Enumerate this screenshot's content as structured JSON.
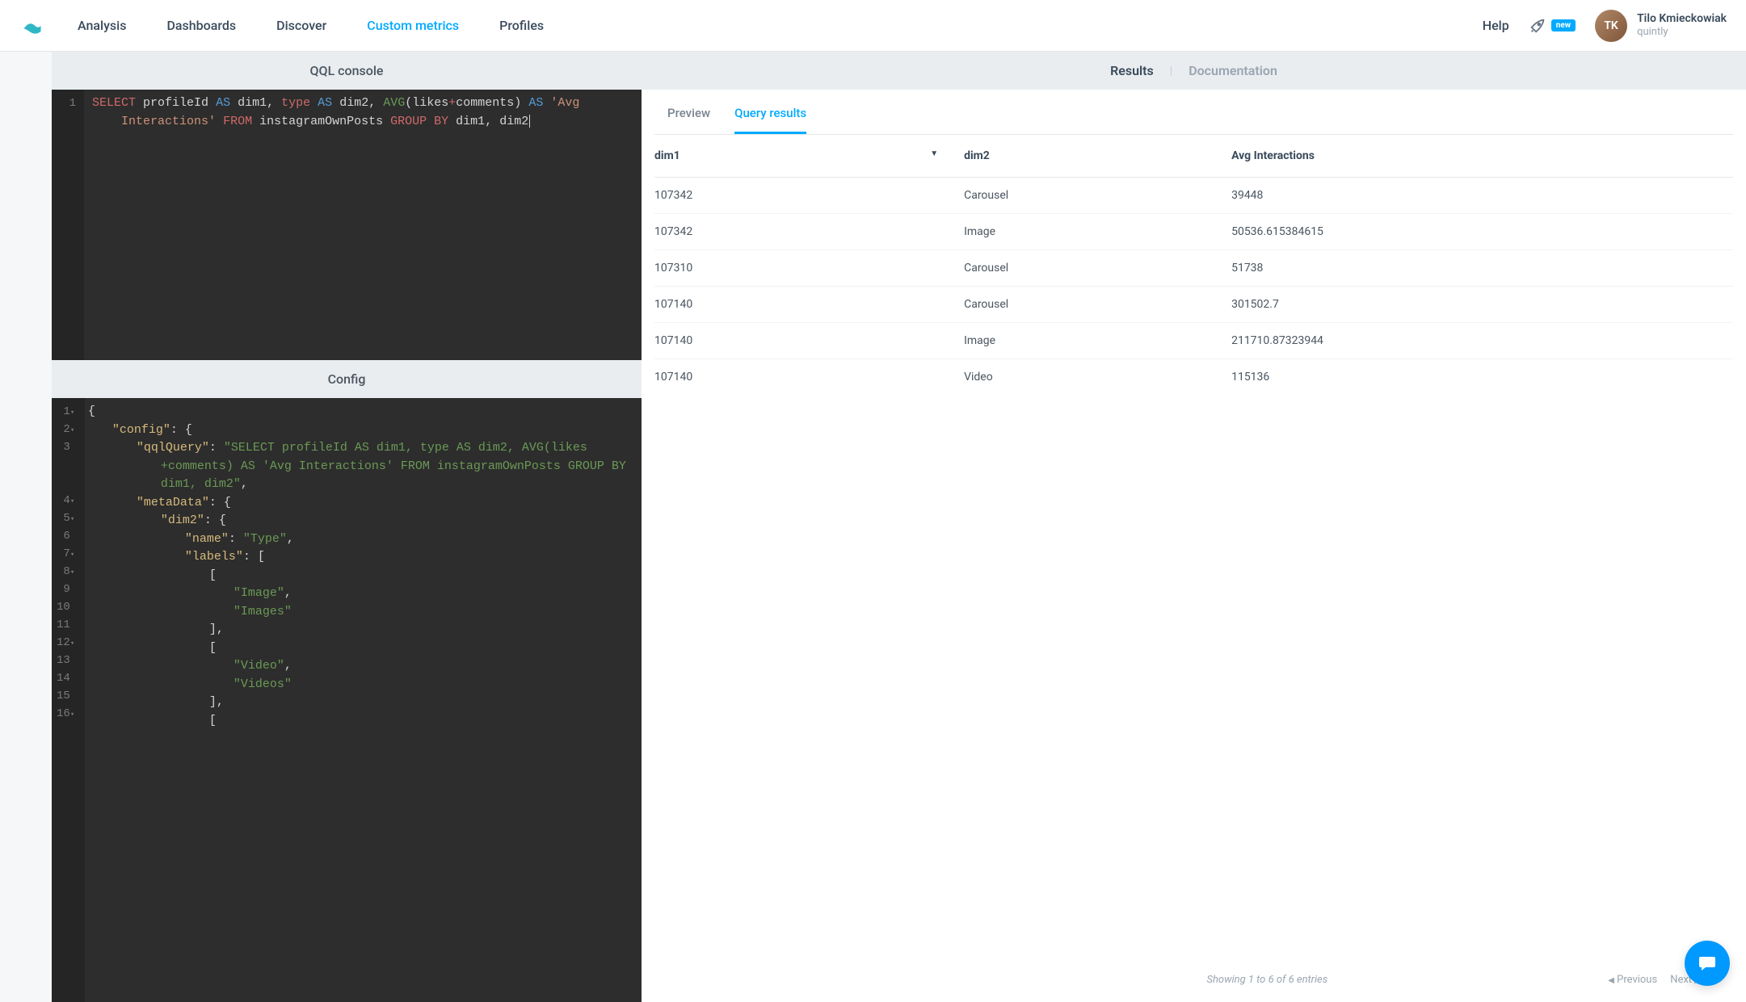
{
  "nav": {
    "items": [
      "Analysis",
      "Dashboards",
      "Discover",
      "Custom metrics",
      "Profiles"
    ],
    "active_index": 3,
    "help": "Help",
    "new_badge": "new"
  },
  "user": {
    "name": "Tilo Kmieckowiak",
    "org": "quintly",
    "initials": "TK"
  },
  "left": {
    "qql_header": "QQL console",
    "config_header": "Config"
  },
  "qql_editor": {
    "gutter": [
      "1"
    ],
    "tokens_line1": [
      {
        "t": "SELECT",
        "c": "kw-select"
      },
      {
        "t": " ",
        "c": "kw-plain"
      },
      {
        "t": "profileId",
        "c": "kw-plain"
      },
      {
        "t": " ",
        "c": "kw-plain"
      },
      {
        "t": "AS",
        "c": "kw-blue"
      },
      {
        "t": " ",
        "c": "kw-plain"
      },
      {
        "t": "dim1",
        "c": "kw-plain"
      },
      {
        "t": ", ",
        "c": "kw-plain"
      },
      {
        "t": "type",
        "c": "kw-type"
      },
      {
        "t": " ",
        "c": "kw-plain"
      },
      {
        "t": "AS",
        "c": "kw-blue"
      },
      {
        "t": " ",
        "c": "kw-plain"
      },
      {
        "t": "dim2",
        "c": "kw-plain"
      },
      {
        "t": ", ",
        "c": "kw-plain"
      },
      {
        "t": "AVG",
        "c": "kw-func"
      },
      {
        "t": "(",
        "c": "kw-plain"
      },
      {
        "t": "likes",
        "c": "kw-plain"
      },
      {
        "t": "+",
        "c": "kw-plus"
      },
      {
        "t": "comments",
        "c": "kw-plain"
      },
      {
        "t": ")",
        "c": "kw-plain"
      },
      {
        "t": " ",
        "c": "kw-plain"
      },
      {
        "t": "AS",
        "c": "kw-blue"
      },
      {
        "t": " ",
        "c": "kw-plain"
      },
      {
        "t": "'Avg ",
        "c": "kw-str"
      }
    ],
    "tokens_line2": [
      {
        "t": "    Interactions'",
        "c": "kw-str"
      },
      {
        "t": " ",
        "c": "kw-plain"
      },
      {
        "t": "FROM",
        "c": "kw-from"
      },
      {
        "t": " ",
        "c": "kw-plain"
      },
      {
        "t": "instagramOwnPosts",
        "c": "kw-plain"
      },
      {
        "t": " ",
        "c": "kw-plain"
      },
      {
        "t": "GROUP BY",
        "c": "kw-group"
      },
      {
        "t": " ",
        "c": "kw-plain"
      },
      {
        "t": "dim1",
        "c": "kw-plain"
      },
      {
        "t": ", ",
        "c": "kw-plain"
      },
      {
        "t": "dim2",
        "c": "kw-plain"
      }
    ]
  },
  "config_editor": {
    "lines": [
      {
        "n": "1",
        "fold": true,
        "indent": 0,
        "tokens": [
          {
            "t": "{",
            "c": "kw-punc"
          }
        ]
      },
      {
        "n": "2",
        "fold": true,
        "indent": 1,
        "tokens": [
          {
            "t": "\"config\"",
            "c": "kw-key"
          },
          {
            "t": ": {",
            "c": "kw-punc"
          }
        ]
      },
      {
        "n": "3",
        "fold": false,
        "indent": 2,
        "tokens": [
          {
            "t": "\"qqlQuery\"",
            "c": "kw-prop"
          },
          {
            "t": ": ",
            "c": "kw-punc"
          },
          {
            "t": "\"SELECT profileId AS dim1, type AS dim2, AVG(likes",
            "c": "kw-json-str"
          }
        ]
      },
      {
        "n": "",
        "fold": false,
        "indent": 3,
        "tokens": [
          {
            "t": "+comments) AS 'Avg Interactions' FROM instagramOwnPosts GROUP BY ",
            "c": "kw-json-str"
          }
        ]
      },
      {
        "n": "",
        "fold": false,
        "indent": 3,
        "tokens": [
          {
            "t": "dim1, dim2\"",
            "c": "kw-json-str"
          },
          {
            "t": ",",
            "c": "kw-punc"
          }
        ]
      },
      {
        "n": "4",
        "fold": true,
        "indent": 2,
        "tokens": [
          {
            "t": "\"metaData\"",
            "c": "kw-prop"
          },
          {
            "t": ": {",
            "c": "kw-punc"
          }
        ]
      },
      {
        "n": "5",
        "fold": true,
        "indent": 3,
        "tokens": [
          {
            "t": "\"dim2\"",
            "c": "kw-prop"
          },
          {
            "t": ": {",
            "c": "kw-punc"
          }
        ]
      },
      {
        "n": "6",
        "fold": false,
        "indent": 4,
        "tokens": [
          {
            "t": "\"name\"",
            "c": "kw-prop"
          },
          {
            "t": ": ",
            "c": "kw-punc"
          },
          {
            "t": "\"Type\"",
            "c": "kw-json-str"
          },
          {
            "t": ",",
            "c": "kw-punc"
          }
        ]
      },
      {
        "n": "7",
        "fold": true,
        "indent": 4,
        "tokens": [
          {
            "t": "\"labels\"",
            "c": "kw-prop"
          },
          {
            "t": ": [",
            "c": "kw-punc"
          }
        ]
      },
      {
        "n": "8",
        "fold": true,
        "indent": 5,
        "tokens": [
          {
            "t": "[",
            "c": "kw-punc"
          }
        ]
      },
      {
        "n": "9",
        "fold": false,
        "indent": 6,
        "tokens": [
          {
            "t": "\"Image\"",
            "c": "kw-json-str"
          },
          {
            "t": ",",
            "c": "kw-punc"
          }
        ]
      },
      {
        "n": "10",
        "fold": false,
        "indent": 6,
        "tokens": [
          {
            "t": "\"Images\"",
            "c": "kw-json-str"
          }
        ]
      },
      {
        "n": "11",
        "fold": false,
        "indent": 5,
        "tokens": [
          {
            "t": "],",
            "c": "kw-punc"
          }
        ]
      },
      {
        "n": "12",
        "fold": true,
        "indent": 5,
        "tokens": [
          {
            "t": "[",
            "c": "kw-punc"
          }
        ]
      },
      {
        "n": "13",
        "fold": false,
        "indent": 6,
        "tokens": [
          {
            "t": "\"Video\"",
            "c": "kw-json-str"
          },
          {
            "t": ",",
            "c": "kw-punc"
          }
        ]
      },
      {
        "n": "14",
        "fold": false,
        "indent": 6,
        "tokens": [
          {
            "t": "\"Videos\"",
            "c": "kw-json-str"
          }
        ]
      },
      {
        "n": "15",
        "fold": false,
        "indent": 5,
        "tokens": [
          {
            "t": "],",
            "c": "kw-punc"
          }
        ]
      },
      {
        "n": "16",
        "fold": true,
        "indent": 5,
        "tokens": [
          {
            "t": "[",
            "c": "kw-punc"
          }
        ]
      }
    ]
  },
  "right": {
    "tabs": {
      "results": "Results",
      "documentation": "Documentation"
    },
    "sub_tabs": {
      "preview": "Preview",
      "query_results": "Query results"
    },
    "footer_text": "Showing 1 to 6 of 6 entries",
    "prev": "Previous",
    "next": "Next"
  },
  "table": {
    "headers": [
      "dim1",
      "dim2",
      "Avg Interactions"
    ],
    "sort_col": 0,
    "rows": [
      [
        "107342",
        "Carousel",
        "39448"
      ],
      [
        "107342",
        "Image",
        "50536.615384615"
      ],
      [
        "107310",
        "Carousel",
        "51738"
      ],
      [
        "107140",
        "Carousel",
        "301502.7"
      ],
      [
        "107140",
        "Image",
        "211710.87323944"
      ],
      [
        "107140",
        "Video",
        "115136"
      ]
    ]
  }
}
